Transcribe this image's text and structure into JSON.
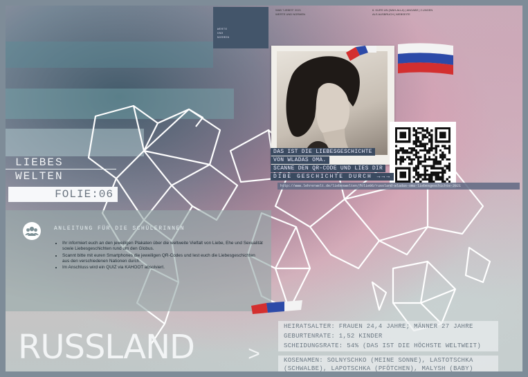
{
  "title": {
    "line1": "LIEBES",
    "line2": "WELTEN",
    "slide": "FOLIE:06"
  },
  "header": {
    "nav_box": [
      "WERTE",
      "UND",
      "NORMEN"
    ],
    "left": [
      "WAB  \"LIEBES\" 2021",
      "WERTE UND NORMEN"
    ],
    "right": [
      "6. KURS UN  (WAH-ALLA)  | ANGABE | 2.UNGEN",
      "ALS AUSBRUCH  |  WEBSEITE"
    ]
  },
  "photo": {
    "caption": [
      "DAS IST DIE LIEBESGESCHICHTE",
      "VON WLADAS OMA.",
      "SCANNE DEN QR-CODE UND LIES DIR",
      "DIBE GESCHICHTE DURCH →→→"
    ]
  },
  "url_bar": "http://www.lehrerwelt.de/liebeswelten/folie06/russland-wladas-oma-liebesgeschichte-2021",
  "instructions": {
    "title": "ANLEITUNG FÜR DIE SCHÜLERINNEN",
    "items": [
      "Ihr informiert euch an den jeweiligen Plakaten über die weltweite Vielfalt von Liebe, Ehe und Sexualität sowie Liebesgeschichten rund um den Globus.",
      "Scannt bitte mit euren Smartphones die jeweiligen QR-Codes und lest euch die Liebesgeschichten aus den verschiedenen Nationen durch.",
      "Im Anschluss wird ein QUIZ via KAHOOT absolviert."
    ]
  },
  "country": "RUSSLAND",
  "next_label": ">",
  "facts": [
    "HEIRATSALTER: FRAUEN 24,4 JAHRE; MÄNNER 27 JAHRE",
    "GEBURTENRATE: 1,52 KINDER",
    "SCHEIDUNGSRATE: 54% (DAS IST DIE HÖCHSTE WELTWEIT)"
  ],
  "nicknames": [
    "KOSENAMEN: SOLNYSCHKO (MEINE SONNE), LASTOTSCHKA",
    "(SCHWALBE), LAPOTSCHKA (PFÖTCHEN), MALYSH (BABY)"
  ],
  "colors": {
    "flag_white": "#f3f3f3",
    "flag_blue": "#2c4aa8",
    "flag_red": "#d32f2f",
    "caption_bg": "#3a4a60",
    "nav_bg": "#43556a"
  },
  "icons": [
    "group-icon",
    "qr-code-icon",
    "russian-flag-icon"
  ]
}
